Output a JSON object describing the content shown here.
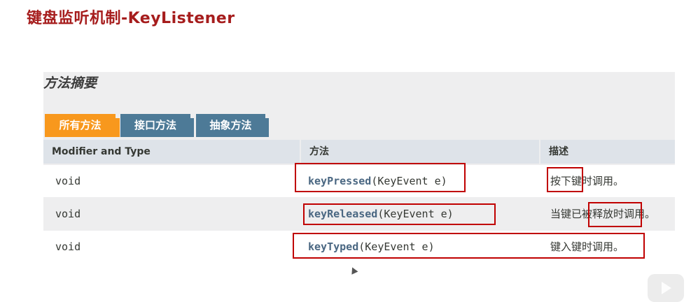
{
  "slide": {
    "title": "键盘监听机制-KeyListener"
  },
  "summary": {
    "title": "方法摘要"
  },
  "tabs": [
    {
      "label": "所有方法",
      "active": true
    },
    {
      "label": "接口方法",
      "active": false
    },
    {
      "label": "抽象方法",
      "active": false
    }
  ],
  "table": {
    "headers": [
      "Modifier and Type",
      "方法",
      "描述"
    ],
    "rows": [
      {
        "type": "void",
        "method_name": "keyPressed",
        "method_params": "(KeyEvent e)",
        "description": "按下键时调用。"
      },
      {
        "type": "void",
        "method_name": "keyReleased",
        "method_params": "(KeyEvent e)",
        "description": "当键已被释放时调用。"
      },
      {
        "type": "void",
        "method_name": "keyTyped",
        "method_params": "(KeyEvent e)",
        "description": "键入键时调用。"
      }
    ]
  },
  "colors": {
    "title": "#a61d1d",
    "tab_active": "#f8981d",
    "tab_inactive": "#4d7a97",
    "annotation": "#c00000",
    "method_link": "#4a6782"
  },
  "icons": {
    "play": "play-icon",
    "cursor": "mouse-pointer-icon"
  }
}
